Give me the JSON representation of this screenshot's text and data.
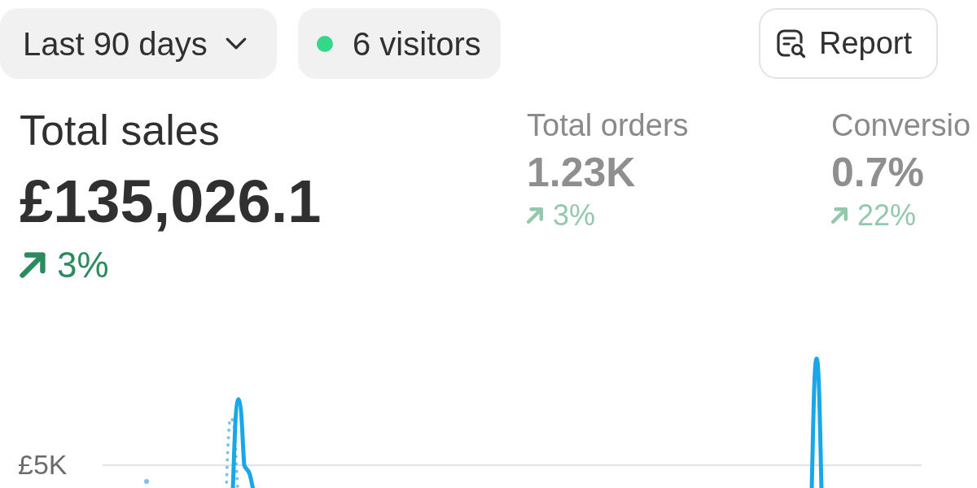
{
  "toolbar": {
    "date_range": {
      "label": "Last 90 days"
    },
    "visitors": {
      "label": "6 visitors",
      "live": true
    },
    "report_button": {
      "label": "Report"
    }
  },
  "metrics": [
    {
      "label": "Total sales",
      "value": "£135,026.1",
      "change": "3%",
      "increase": true,
      "selected": true
    },
    {
      "label": "Total orders",
      "value": "1.23K",
      "change": "3%",
      "increase": true,
      "selected": false
    },
    {
      "label": "Conversio",
      "value": "0.7%",
      "change": "22%",
      "increase": true,
      "selected": false
    }
  ],
  "chart": {
    "y_tick_label": "£5K"
  }
}
